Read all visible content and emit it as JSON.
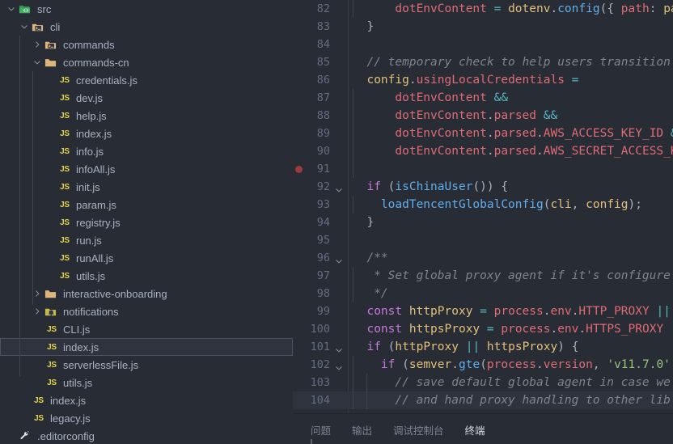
{
  "sidebar": {
    "tree": [
      {
        "name": "src",
        "type": "folder",
        "icon": "folder-source-icon",
        "depth": 0,
        "expanded": true,
        "twisty": "chevron-down"
      },
      {
        "name": "cli",
        "type": "folder",
        "icon": "folder-cli-icon",
        "depth": 1,
        "expanded": true,
        "twisty": "chevron-down"
      },
      {
        "name": "commands",
        "type": "folder",
        "icon": "folder-cli-icon",
        "depth": 2,
        "expanded": false,
        "twisty": "chevron-right"
      },
      {
        "name": "commands-cn",
        "type": "folder",
        "icon": "folder-plain-icon",
        "depth": 2,
        "expanded": true,
        "twisty": "chevron-down"
      },
      {
        "name": "credentials.js",
        "type": "file",
        "icon": "js-file-icon",
        "depth": 3,
        "badge": "JS"
      },
      {
        "name": "dev.js",
        "type": "file",
        "icon": "js-file-icon",
        "depth": 3,
        "badge": "JS"
      },
      {
        "name": "help.js",
        "type": "file",
        "icon": "js-file-icon",
        "depth": 3,
        "badge": "JS"
      },
      {
        "name": "index.js",
        "type": "file",
        "icon": "js-file-icon",
        "depth": 3,
        "badge": "JS"
      },
      {
        "name": "info.js",
        "type": "file",
        "icon": "js-file-icon",
        "depth": 3,
        "badge": "JS"
      },
      {
        "name": "infoAll.js",
        "type": "file",
        "icon": "js-file-icon",
        "depth": 3,
        "badge": "JS"
      },
      {
        "name": "init.js",
        "type": "file",
        "icon": "js-file-icon",
        "depth": 3,
        "badge": "JS"
      },
      {
        "name": "param.js",
        "type": "file",
        "icon": "js-file-icon",
        "depth": 3,
        "badge": "JS"
      },
      {
        "name": "registry.js",
        "type": "file",
        "icon": "js-file-icon",
        "depth": 3,
        "badge": "JS"
      },
      {
        "name": "run.js",
        "type": "file",
        "icon": "js-file-icon",
        "depth": 3,
        "badge": "JS"
      },
      {
        "name": "runAll.js",
        "type": "file",
        "icon": "js-file-icon",
        "depth": 3,
        "badge": "JS"
      },
      {
        "name": "utils.js",
        "type": "file",
        "icon": "js-file-icon",
        "depth": 3,
        "badge": "JS"
      },
      {
        "name": "interactive-onboarding",
        "type": "folder",
        "icon": "folder-plain-icon",
        "depth": 2,
        "expanded": false,
        "twisty": "chevron-right"
      },
      {
        "name": "notifications",
        "type": "folder",
        "icon": "folder-bell-icon",
        "depth": 2,
        "expanded": false,
        "twisty": "chevron-right"
      },
      {
        "name": "CLI.js",
        "type": "file",
        "icon": "js-file-icon",
        "depth": 2,
        "badge": "JS"
      },
      {
        "name": "index.js",
        "type": "file",
        "icon": "js-file-icon",
        "depth": 2,
        "badge": "JS",
        "selected": true
      },
      {
        "name": "serverlessFile.js",
        "type": "file",
        "icon": "js-file-icon",
        "depth": 2,
        "badge": "JS"
      },
      {
        "name": "utils.js",
        "type": "file",
        "icon": "js-file-icon",
        "depth": 2,
        "badge": "JS"
      },
      {
        "name": "index.js",
        "type": "file",
        "icon": "js-file-icon",
        "depth": 1,
        "badge": "JS"
      },
      {
        "name": "legacy.js",
        "type": "file",
        "icon": "js-file-icon",
        "depth": 1,
        "badge": "JS"
      },
      {
        "name": ".editorconfig",
        "type": "file",
        "icon": "editorconfig-icon",
        "depth": 0,
        "badge": ""
      }
    ]
  },
  "editor": {
    "lines": [
      {
        "num": "82",
        "fold": "",
        "breakpoint": false,
        "current": false,
        "indents": [
          1
        ],
        "tokens": [
          {
            "t": "      ",
            "c": "t-def"
          },
          {
            "t": "dotEnvContent ",
            "c": "t-var"
          },
          {
            "t": "= ",
            "c": "t-op"
          },
          {
            "t": "dotenv",
            "c": "t-kw2"
          },
          {
            "t": ".",
            "c": "t-pun"
          },
          {
            "t": "config",
            "c": "t-fn"
          },
          {
            "t": "({ ",
            "c": "t-pun"
          },
          {
            "t": "path",
            "c": "t-var"
          },
          {
            "t": ": ",
            "c": "t-pun"
          },
          {
            "t": "pat",
            "c": "t-kw2"
          }
        ]
      },
      {
        "num": "83",
        "fold": "",
        "breakpoint": false,
        "current": false,
        "indents": [],
        "tokens": [
          {
            "t": "  }",
            "c": "t-def"
          }
        ]
      },
      {
        "num": "84",
        "fold": "",
        "breakpoint": false,
        "current": false,
        "indents": [],
        "tokens": []
      },
      {
        "num": "85",
        "fold": "",
        "breakpoint": false,
        "current": false,
        "indents": [],
        "tokens": [
          {
            "t": "  // temporary check to help users transition",
            "c": "t-com"
          }
        ]
      },
      {
        "num": "86",
        "fold": "",
        "breakpoint": false,
        "current": false,
        "indents": [],
        "tokens": [
          {
            "t": "  ",
            "c": "t-def"
          },
          {
            "t": "config",
            "c": "t-kw2"
          },
          {
            "t": ".",
            "c": "t-pun"
          },
          {
            "t": "usingLocalCredentials ",
            "c": "t-var"
          },
          {
            "t": "=",
            "c": "t-op"
          }
        ]
      },
      {
        "num": "87",
        "fold": "",
        "breakpoint": false,
        "current": false,
        "indents": [
          1
        ],
        "tokens": [
          {
            "t": "      ",
            "c": "t-def"
          },
          {
            "t": "dotEnvContent ",
            "c": "t-var"
          },
          {
            "t": "&&",
            "c": "t-op"
          }
        ]
      },
      {
        "num": "88",
        "fold": "",
        "breakpoint": false,
        "current": false,
        "indents": [
          1
        ],
        "tokens": [
          {
            "t": "      ",
            "c": "t-def"
          },
          {
            "t": "dotEnvContent",
            "c": "t-var"
          },
          {
            "t": ".",
            "c": "t-pun"
          },
          {
            "t": "parsed ",
            "c": "t-prop"
          },
          {
            "t": "&&",
            "c": "t-op"
          }
        ]
      },
      {
        "num": "89",
        "fold": "",
        "breakpoint": false,
        "current": false,
        "indents": [
          1
        ],
        "tokens": [
          {
            "t": "      ",
            "c": "t-def"
          },
          {
            "t": "dotEnvContent",
            "c": "t-var"
          },
          {
            "t": ".",
            "c": "t-pun"
          },
          {
            "t": "parsed",
            "c": "t-prop"
          },
          {
            "t": ".",
            "c": "t-pun"
          },
          {
            "t": "AWS_ACCESS_KEY_ID ",
            "c": "t-prop"
          },
          {
            "t": "&&",
            "c": "t-op"
          }
        ]
      },
      {
        "num": "90",
        "fold": "",
        "breakpoint": false,
        "current": false,
        "indents": [
          1
        ],
        "tokens": [
          {
            "t": "      ",
            "c": "t-def"
          },
          {
            "t": "dotEnvContent",
            "c": "t-var"
          },
          {
            "t": ".",
            "c": "t-pun"
          },
          {
            "t": "parsed",
            "c": "t-prop"
          },
          {
            "t": ".",
            "c": "t-pun"
          },
          {
            "t": "AWS_SECRET_ACCESS_KE",
            "c": "t-prop"
          }
        ]
      },
      {
        "num": "91",
        "fold": "",
        "breakpoint": true,
        "current": false,
        "indents": [
          1
        ],
        "tokens": []
      },
      {
        "num": "92",
        "fold": "chevron-down",
        "breakpoint": false,
        "current": false,
        "indents": [],
        "tokens": [
          {
            "t": "  ",
            "c": "t-def"
          },
          {
            "t": "if ",
            "c": "t-key"
          },
          {
            "t": "(",
            "c": "t-pun"
          },
          {
            "t": "isChinaUser",
            "c": "t-fn"
          },
          {
            "t": "()) {",
            "c": "t-pun"
          }
        ]
      },
      {
        "num": "93",
        "fold": "",
        "breakpoint": false,
        "current": false,
        "indents": [
          1
        ],
        "tokens": [
          {
            "t": "    ",
            "c": "t-def"
          },
          {
            "t": "loadTencentGlobalConfig",
            "c": "t-fn"
          },
          {
            "t": "(",
            "c": "t-pun"
          },
          {
            "t": "cli",
            "c": "t-param"
          },
          {
            "t": ", ",
            "c": "t-pun"
          },
          {
            "t": "config",
            "c": "t-param"
          },
          {
            "t": ");",
            "c": "t-pun"
          }
        ]
      },
      {
        "num": "94",
        "fold": "",
        "breakpoint": false,
        "current": false,
        "indents": [],
        "tokens": [
          {
            "t": "  }",
            "c": "t-def"
          }
        ]
      },
      {
        "num": "95",
        "fold": "",
        "breakpoint": false,
        "current": false,
        "indents": [],
        "tokens": []
      },
      {
        "num": "96",
        "fold": "chevron-down",
        "breakpoint": false,
        "current": false,
        "indents": [],
        "tokens": [
          {
            "t": "  /**",
            "c": "t-com"
          }
        ]
      },
      {
        "num": "97",
        "fold": "",
        "breakpoint": false,
        "current": false,
        "indents": [
          1
        ],
        "tokens": [
          {
            "t": "   * Set global proxy agent if it's configure",
            "c": "t-com"
          }
        ]
      },
      {
        "num": "98",
        "fold": "",
        "breakpoint": false,
        "current": false,
        "indents": [
          1
        ],
        "tokens": [
          {
            "t": "   */",
            "c": "t-com"
          }
        ]
      },
      {
        "num": "99",
        "fold": "",
        "breakpoint": false,
        "current": false,
        "indents": [],
        "tokens": [
          {
            "t": "  ",
            "c": "t-def"
          },
          {
            "t": "const ",
            "c": "t-key"
          },
          {
            "t": "httpProxy ",
            "c": "t-kw2"
          },
          {
            "t": "= ",
            "c": "t-op"
          },
          {
            "t": "process",
            "c": "t-var"
          },
          {
            "t": ".",
            "c": "t-pun"
          },
          {
            "t": "env",
            "c": "t-prop"
          },
          {
            "t": ".",
            "c": "t-pun"
          },
          {
            "t": "HTTP_PROXY ",
            "c": "t-prop"
          },
          {
            "t": "||",
            "c": "t-op"
          }
        ]
      },
      {
        "num": "100",
        "fold": "",
        "breakpoint": false,
        "current": false,
        "indents": [],
        "tokens": [
          {
            "t": "  ",
            "c": "t-def"
          },
          {
            "t": "const ",
            "c": "t-key"
          },
          {
            "t": "httpsProxy ",
            "c": "t-kw2"
          },
          {
            "t": "= ",
            "c": "t-op"
          },
          {
            "t": "process",
            "c": "t-var"
          },
          {
            "t": ".",
            "c": "t-pun"
          },
          {
            "t": "env",
            "c": "t-prop"
          },
          {
            "t": ".",
            "c": "t-pun"
          },
          {
            "t": "HTTPS_PROXY",
            "c": "t-prop"
          }
        ]
      },
      {
        "num": "101",
        "fold": "chevron-down",
        "breakpoint": false,
        "current": false,
        "indents": [],
        "tokens": [
          {
            "t": "  ",
            "c": "t-def"
          },
          {
            "t": "if ",
            "c": "t-key"
          },
          {
            "t": "(",
            "c": "t-pun"
          },
          {
            "t": "httpProxy ",
            "c": "t-kw2"
          },
          {
            "t": "|| ",
            "c": "t-op"
          },
          {
            "t": "httpsProxy",
            "c": "t-kw2"
          },
          {
            "t": ") {",
            "c": "t-pun"
          }
        ]
      },
      {
        "num": "102",
        "fold": "chevron-down",
        "breakpoint": false,
        "current": false,
        "indents": [
          1
        ],
        "tokens": [
          {
            "t": "    ",
            "c": "t-def"
          },
          {
            "t": "if ",
            "c": "t-key"
          },
          {
            "t": "(",
            "c": "t-pun"
          },
          {
            "t": "semver",
            "c": "t-kw2"
          },
          {
            "t": ".",
            "c": "t-pun"
          },
          {
            "t": "gte",
            "c": "t-fn"
          },
          {
            "t": "(",
            "c": "t-pun"
          },
          {
            "t": "process",
            "c": "t-var"
          },
          {
            "t": ".",
            "c": "t-pun"
          },
          {
            "t": "version",
            "c": "t-prop"
          },
          {
            "t": ", ",
            "c": "t-pun"
          },
          {
            "t": "'v11.7.0'",
            "c": "t-str"
          }
        ]
      },
      {
        "num": "103",
        "fold": "",
        "breakpoint": false,
        "current": false,
        "indents": [
          1,
          2
        ],
        "tokens": [
          {
            "t": "      // save default global agent in case we",
            "c": "t-com"
          }
        ]
      },
      {
        "num": "104",
        "fold": "",
        "breakpoint": false,
        "current": true,
        "indents": [
          1,
          2
        ],
        "tokens": [
          {
            "t": "      // and hand proxy handling to other lib",
            "c": "t-com"
          }
        ]
      }
    ]
  },
  "panel": {
    "tabs": [
      {
        "label": "问题",
        "active": false
      },
      {
        "label": "输出",
        "active": false
      },
      {
        "label": "调试控制台",
        "active": false
      },
      {
        "label": "终端",
        "active": true
      }
    ]
  },
  "colors": {
    "sidebar_bg": "#282c34",
    "editor_bg": "#282c34",
    "accent": "#61afef",
    "js_badge": "#e6d44a",
    "breakpoint": "#9c3b3b",
    "folder_yellow": "#dcb67a",
    "folder_green": "#4aa96c"
  }
}
